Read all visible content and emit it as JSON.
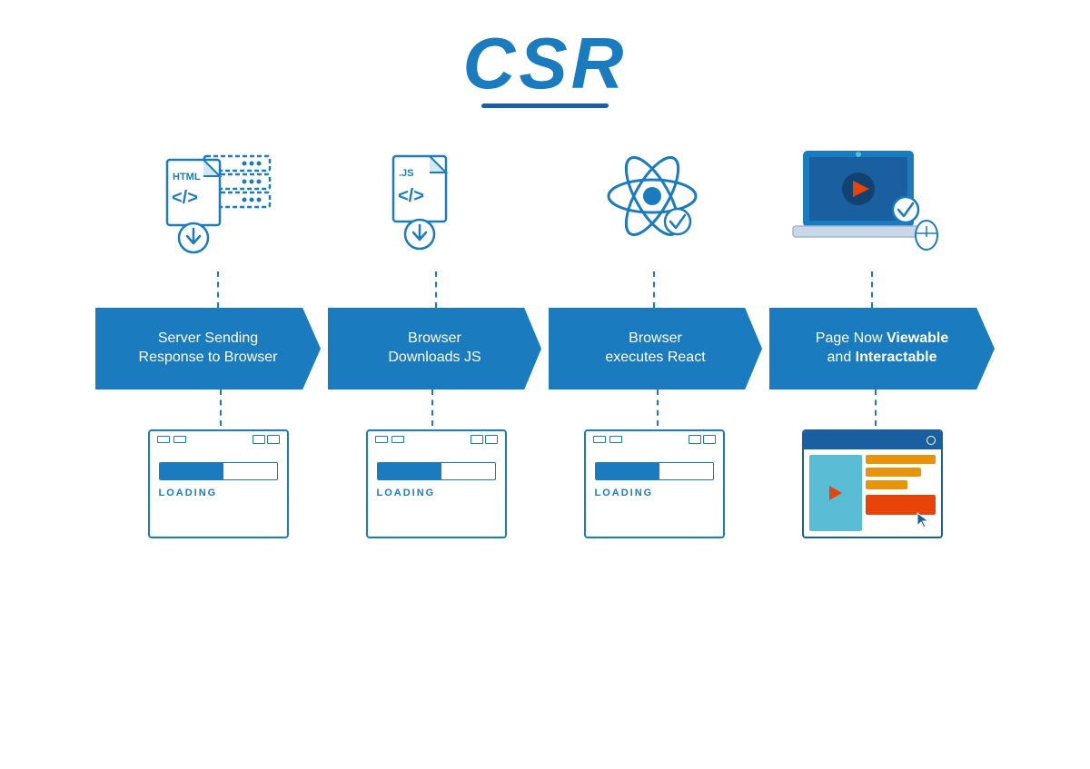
{
  "title": {
    "text": "CSR",
    "underline": true
  },
  "steps": [
    {
      "id": 1,
      "icon": "html-file",
      "arrow_label_line1": "Server Sending",
      "arrow_label_line2": "Response to Browser",
      "bottom_icon": "loading-screen",
      "loading_text": "LOADING"
    },
    {
      "id": 2,
      "icon": "js-file",
      "arrow_label_line1": "Browser",
      "arrow_label_line2": "Downloads JS",
      "bottom_icon": "loading-screen",
      "loading_text": "LOADING"
    },
    {
      "id": 3,
      "icon": "react-atom",
      "arrow_label_line1": "Browser",
      "arrow_label_line2": "executes React",
      "bottom_icon": "loading-screen",
      "loading_text": "LOADING"
    },
    {
      "id": 4,
      "icon": "laptop",
      "arrow_label_line1": "Page Now ",
      "arrow_label_bold1": "Viewable",
      "arrow_label_line2": "and ",
      "arrow_label_bold2": "Interactable",
      "bottom_icon": "website",
      "loading_text": ""
    }
  ],
  "colors": {
    "blue": "#1a7bbf",
    "dark_blue": "#1a5fa0",
    "orange": "#e8440a",
    "yellow": "#e8940a",
    "light_blue": "#5bbcd6"
  }
}
